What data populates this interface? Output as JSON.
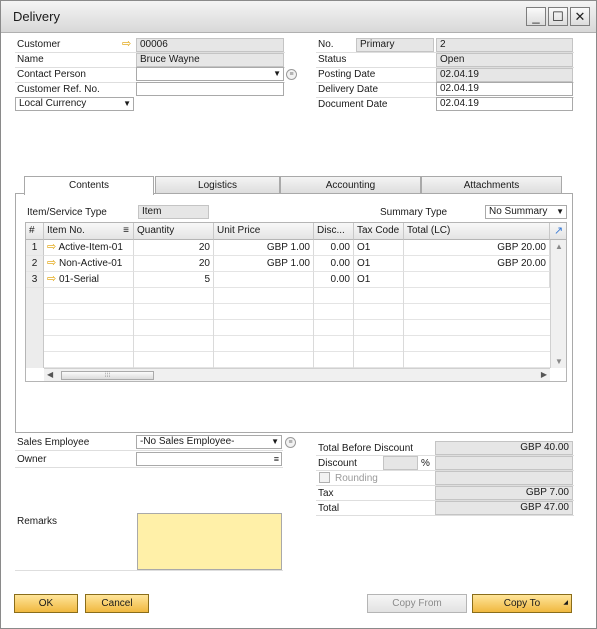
{
  "window": {
    "title": "Delivery",
    "minimize": "_",
    "maximize": "☐",
    "close": "✕"
  },
  "left": {
    "customer_label": "Customer",
    "customer_value": "00006",
    "name_label": "Name",
    "name_value": "Bruce Wayne",
    "contact_label": "Contact Person",
    "contact_value": "",
    "ref_label": "Customer Ref. No.",
    "ref_value": "",
    "currency_value": "Local Currency"
  },
  "right": {
    "no_label": "No.",
    "no_series": "Primary",
    "no_value": "2",
    "status_label": "Status",
    "status_value": "Open",
    "posting_label": "Posting Date",
    "posting_value": "02.04.19",
    "delivery_label": "Delivery Date",
    "delivery_value": "02.04.19",
    "document_label": "Document Date",
    "document_value": "02.04.19"
  },
  "tabs": [
    {
      "label": "Contents"
    },
    {
      "label": "Logistics"
    },
    {
      "label": "Accounting"
    },
    {
      "label": "Attachments"
    }
  ],
  "contents": {
    "item_type_label": "Item/Service Type",
    "item_type_value": "Item",
    "summary_label": "Summary Type",
    "summary_value": "No Summary"
  },
  "grid": {
    "headers": [
      "#",
      "Item No.",
      "Quantity",
      "Unit Price",
      "Disc...",
      "Tax Code",
      "Total (LC)"
    ],
    "rows": [
      {
        "n": "1",
        "item": "Active-Item-01",
        "qty": "20",
        "price": "GBP 1.00",
        "disc": "0.00",
        "tax": "O1",
        "total": "GBP 20.00"
      },
      {
        "n": "2",
        "item": "Non-Active-01",
        "qty": "20",
        "price": "GBP 1.00",
        "disc": "0.00",
        "tax": "O1",
        "total": "GBP 20.00"
      },
      {
        "n": "3",
        "item": "01-Serial",
        "qty": "5",
        "price": "",
        "disc": "0.00",
        "tax": "O1",
        "total": ""
      }
    ]
  },
  "footer": {
    "sales_emp_label": "Sales Employee",
    "sales_emp_value": "-No Sales Employee-",
    "owner_label": "Owner",
    "owner_value": "",
    "remarks_label": "Remarks",
    "remarks_value": "",
    "tbd_label": "Total Before Discount",
    "tbd_value": "GBP 40.00",
    "discount_label": "Discount",
    "discount_pct": "%",
    "rounding_label": "Rounding",
    "tax_label": "Tax",
    "tax_value": "GBP 7.00",
    "total_label": "Total",
    "total_value": "GBP 47.00"
  },
  "buttons": {
    "ok": "OK",
    "cancel": "Cancel",
    "copy_from": "Copy From",
    "copy_to": "Copy To"
  },
  "colors": {
    "accent": "#f0b840",
    "remarks_bg": "#fff0a8",
    "link_arrow": "#e0a000"
  }
}
